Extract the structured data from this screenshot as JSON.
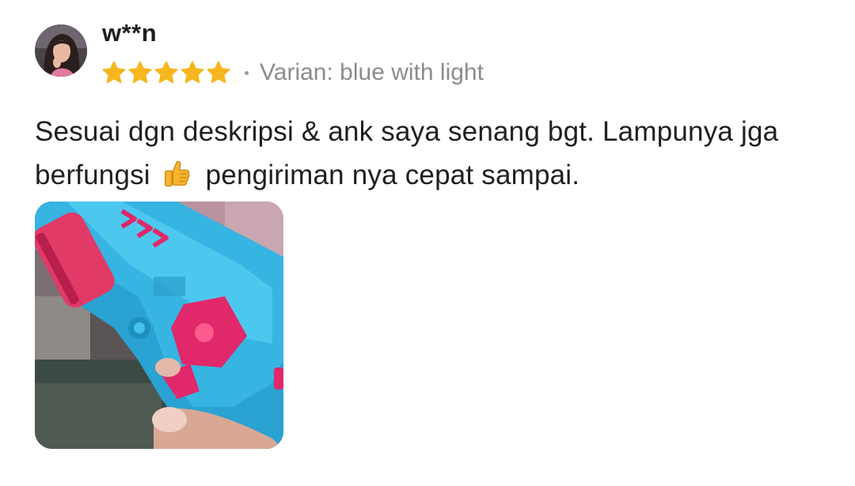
{
  "review": {
    "username": "w**n",
    "rating": 5,
    "rating_max": 5,
    "variant_text": "Varian: blue with light",
    "text_part1": "Sesuai dgn deskripsi & ank saya senang bgt. Lampunya jga berfungsi",
    "text_emoji": "thumbs-up-icon",
    "text_part2": "pengiriman nya cepat sampai.",
    "star_color": "#F6B61E",
    "photo_subject": "toy-gun-photo"
  }
}
